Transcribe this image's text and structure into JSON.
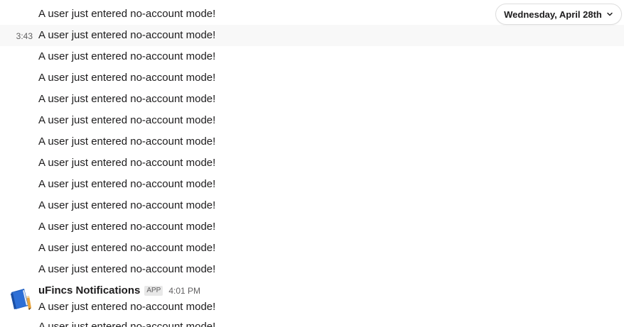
{
  "date_divider": {
    "label": "Wednesday, April 28th"
  },
  "messages": [
    {
      "time": "",
      "text": "A user just entered no-account mode!"
    },
    {
      "time": "3:43",
      "text": "A user just entered no-account mode!"
    },
    {
      "time": "",
      "text": "A user just entered no-account mode!"
    },
    {
      "time": "",
      "text": "A user just entered no-account mode!"
    },
    {
      "time": "",
      "text": "A user just entered no-account mode!"
    },
    {
      "time": "",
      "text": "A user just entered no-account mode!"
    },
    {
      "time": "",
      "text": "A user just entered no-account mode!"
    },
    {
      "time": "",
      "text": "A user just entered no-account mode!"
    },
    {
      "time": "",
      "text": "A user just entered no-account mode!"
    },
    {
      "time": "",
      "text": "A user just entered no-account mode!"
    },
    {
      "time": "",
      "text": "A user just entered no-account mode!"
    },
    {
      "time": "",
      "text": "A user just entered no-account mode!"
    },
    {
      "time": "",
      "text": "A user just entered no-account mode!"
    }
  ],
  "group": {
    "sender": "uFincs Notifications",
    "badge": "APP",
    "time": "4:01 PM",
    "messages": [
      "A user just entered no-account mode!",
      "A user just entered no-account mode!"
    ]
  },
  "icons": {
    "chevron": "chevron-down-icon",
    "avatar": "notebook-icon"
  },
  "colors": {
    "hover_row": "#f8f8f8",
    "muted_text": "#616061",
    "primary_text": "#1d1c1d",
    "avatar_blue": "#2d6fd6",
    "avatar_pencil": "#e8a33a"
  }
}
